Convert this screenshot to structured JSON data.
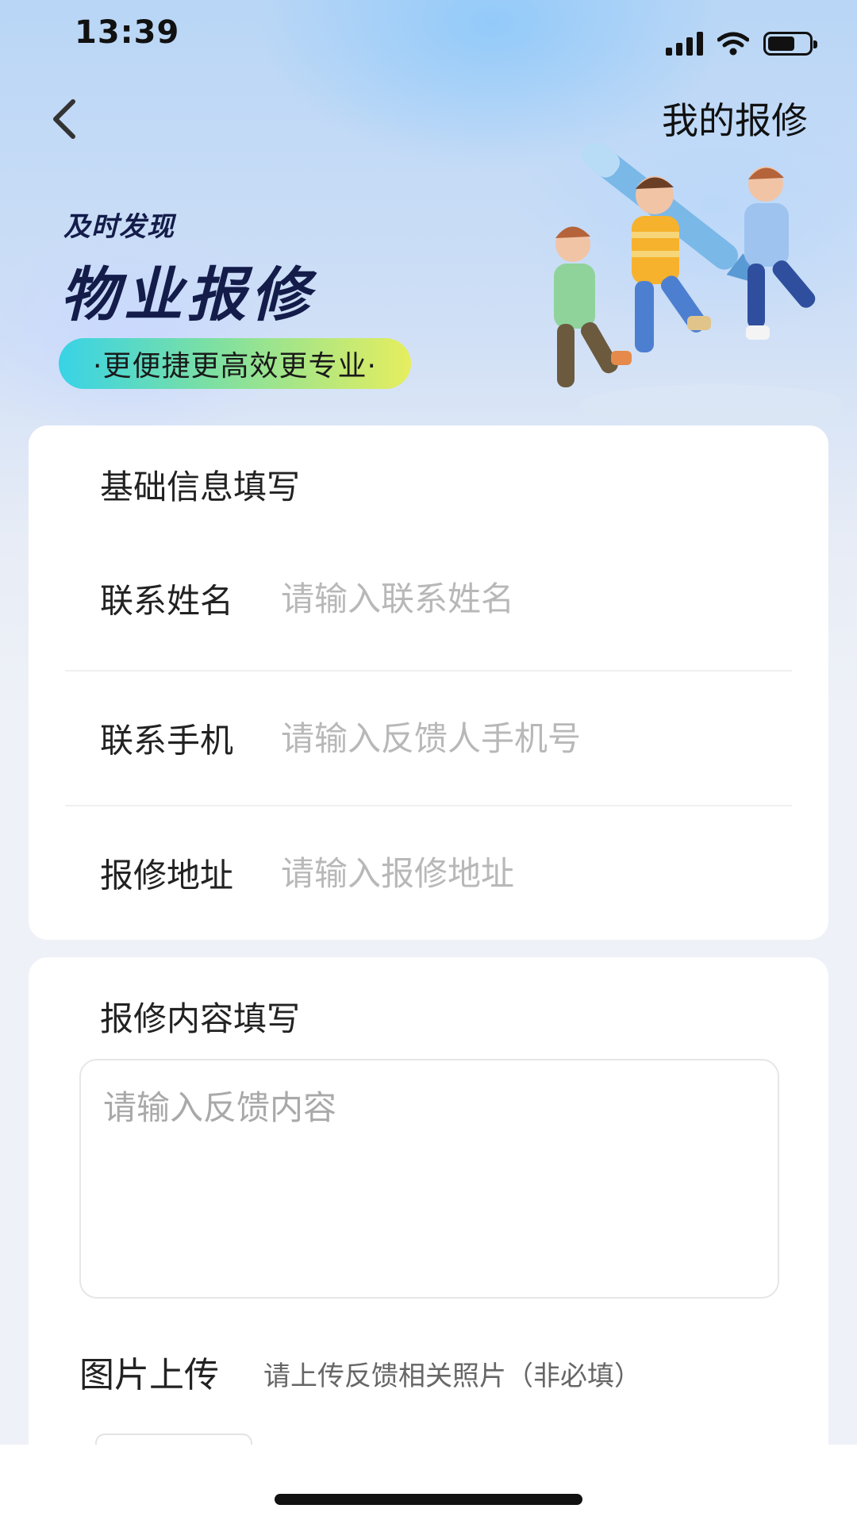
{
  "status_bar": {
    "time": "13:39",
    "battery_level": 0.65
  },
  "nav": {
    "title": "我的报修",
    "back_icon": "chevron-left-icon"
  },
  "hero": {
    "subtitle": "及时发现",
    "title": "物业报修",
    "tagline": "·更便捷更高效更专业·"
  },
  "basic_info": {
    "section_title": "基础信息填写",
    "fields": [
      {
        "label": "联系姓名",
        "placeholder": "请输入联系姓名",
        "value": ""
      },
      {
        "label": "联系手机",
        "placeholder": "请输入反馈人手机号",
        "value": ""
      },
      {
        "label": "报修地址",
        "placeholder": "请输入报修地址",
        "value": ""
      }
    ]
  },
  "content_info": {
    "section_title": "报修内容填写",
    "textarea_placeholder": "请输入反馈内容",
    "upload_label": "图片上传",
    "upload_hint": "请上传反馈相关照片（非必填）"
  },
  "colors": {
    "page_bg": "#eef1f7",
    "hero_title": "#141c4a",
    "pill_gradient": [
      "#38d3e6",
      "#7fe0a0",
      "#e6ee5e"
    ],
    "placeholder": "#b8b8b8"
  }
}
